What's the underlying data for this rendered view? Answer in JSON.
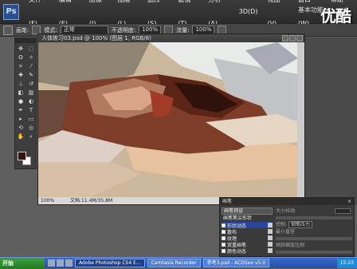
{
  "app": {
    "logo": "Ps",
    "menus": [
      "文件(F)",
      "编辑(E)",
      "图像(I)",
      "图层(L)",
      "选择(S)",
      "滤镜(T)",
      "分析(A)",
      "3D(D)",
      "视图(V)",
      "窗口(W)",
      "帮助(H)"
    ],
    "workspace": "基本功能 ▾",
    "watermark": "优酷"
  },
  "options": {
    "brush_label": "画笔:",
    "mode_label": "模式:",
    "mode_value": "正常",
    "opacity_label": "不透明度:",
    "opacity_value": "100%",
    "flow_label": "流量:",
    "flow_value": "100%"
  },
  "document": {
    "title": "人体练习03.psd @ 100% (图层 1, RGB/8)",
    "zoom": "100%",
    "doc_info": "文档:11.4M/35.8M"
  },
  "panel": {
    "title": "画笔",
    "close": "×",
    "preset_button": "画笔预设",
    "brush_tip": "画笔笔尖形状",
    "options": [
      {
        "label": "形状动态",
        "selected": true
      },
      {
        "label": "散布",
        "selected": false
      },
      {
        "label": "纹理",
        "selected": false
      },
      {
        "label": "双重画笔",
        "selected": false
      },
      {
        "label": "颜色动态",
        "selected": false
      }
    ],
    "size_jitter": "大小抖动",
    "control_label": "控制:",
    "control_value": "钢笔压力",
    "min_diameter": "最小直径",
    "tilt_scale": "倾斜缩放比例"
  },
  "taskbar": {
    "start": "开始",
    "tasks": [
      {
        "label": "Adobe Photoshop CS4 E...",
        "active": true
      },
      {
        "label": "Camtasia Recorder",
        "active": false
      },
      {
        "label": "参考3.psd - ACDSee v5.0",
        "active": false
      }
    ],
    "clock": "15:23"
  },
  "colors": {
    "foreground": "#3a0f07",
    "background": "#ffffff",
    "panel_selected": "#26459e",
    "taskbar": "#2450a8"
  }
}
